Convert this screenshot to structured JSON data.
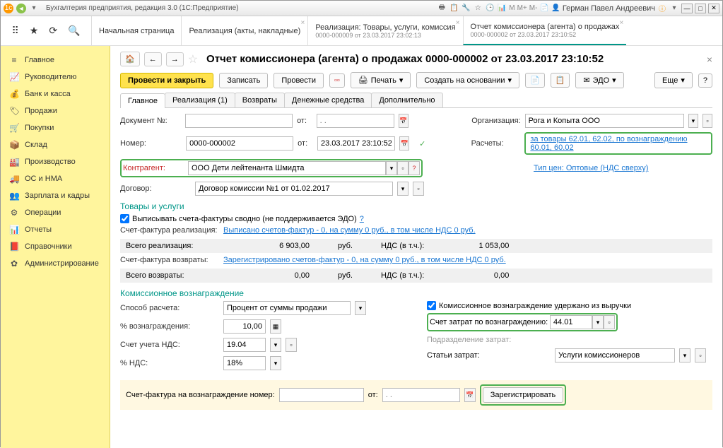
{
  "titlebar": {
    "app_title": "Бухгалтерия предприятия, редакция 3.0 (1С:Предприятие)",
    "user_name": "Герман Павел Андреевич",
    "m_labels": [
      "M",
      "M+",
      "M-"
    ]
  },
  "toolbar_tabs": [
    {
      "label": "Начальная страница",
      "sub": ""
    },
    {
      "label": "Реализация (акты, накладные)",
      "sub": ""
    },
    {
      "label": "Реализация: Товары, услуги, комиссия",
      "sub": "0000-000009 от 23.03.2017 23:02:13"
    },
    {
      "label": "Отчет комиссионера (агента) о продажах",
      "sub": "0000-000002 от 23.03.2017 23:10:52",
      "active": true
    }
  ],
  "sidebar": [
    {
      "icon": "≡",
      "label": "Главное"
    },
    {
      "icon": "📈",
      "label": "Руководителю"
    },
    {
      "icon": "💰",
      "label": "Банк и касса"
    },
    {
      "icon": "🏷",
      "label": "Продажи"
    },
    {
      "icon": "🛒",
      "label": "Покупки"
    },
    {
      "icon": "📦",
      "label": "Склад"
    },
    {
      "icon": "🏭",
      "label": "Производство"
    },
    {
      "icon": "🚚",
      "label": "ОС и НМА"
    },
    {
      "icon": "👥",
      "label": "Зарплата и кадры"
    },
    {
      "icon": "⚙",
      "label": "Операции"
    },
    {
      "icon": "📊",
      "label": "Отчеты"
    },
    {
      "icon": "📕",
      "label": "Справочники"
    },
    {
      "icon": "✿",
      "label": "Администрирование"
    }
  ],
  "main": {
    "title": "Отчет комиссионера (агента) о продажах 0000-000002 от 23.03.2017 23:10:52",
    "actions": {
      "post_close": "Провести и закрыть",
      "save": "Записать",
      "post": "Провести",
      "print": "Печать",
      "create_based": "Создать на основании",
      "edo": "ЭДО",
      "more": "Еще"
    },
    "subtabs": [
      "Главное",
      "Реализация (1)",
      "Возвраты",
      "Денежные средства",
      "Дополнительно"
    ],
    "fields": {
      "doc_num_label": "Документ №:",
      "from_label": "от:",
      "date_placeholder": ". .",
      "org_label": "Организация:",
      "org_value": "Рога и Копыта ООО",
      "number_label": "Номер:",
      "number_value": "0000-000002",
      "datetime_value": "23.03.2017 23:10:52",
      "calc_label": "Расчеты:",
      "calc_link": "за товары 62.01, 62.02, по вознаграждению 60.01, 60.02",
      "counterparty_label": "Контрагент:",
      "counterparty_value": "ООО Дети лейтенанта Шмидта",
      "price_type_label": "Тип цен: Оптовые (НДС сверху)",
      "contract_label": "Договор:",
      "contract_value": "Договор комиссии №1 от 01.02.2017"
    },
    "goods_section": {
      "title": "Товары и услуги",
      "checkbox_label": "Выписывать счета-фактуры сводно (не поддерживается ЭДО)",
      "help": "?",
      "invoice_real_label": "Счет-фактура реализация:",
      "invoice_real_link": "Выписано счетов-фактур - 0, на сумму 0 руб., в том числе НДС 0 руб.",
      "total_real_label": "Всего реализация:",
      "total_real_value": "6 903,00",
      "currency": "руб.",
      "vat_incl_label": "НДС (в т.ч.):",
      "vat_real_value": "1 053,00",
      "invoice_ret_label": "Счет-фактура возвраты:",
      "invoice_ret_link": "Зарегистрировано счетов-фактур - 0, на сумму 0 руб., в том числе НДС 0 руб.",
      "total_ret_label": "Всего возвраты:",
      "total_ret_value": "0,00",
      "vat_ret_value": "0,00"
    },
    "commission_section": {
      "title": "Комиссионное вознаграждение",
      "method_label": "Способ расчета:",
      "method_value": "Процент от суммы продажи",
      "withheld_label": "Комиссионное вознаграждение удержано из выручки",
      "percent_label": "% вознаграждения:",
      "percent_value": "10,00",
      "expense_acc_label": "Счет затрат по вознаграждению:",
      "expense_acc_value": "44.01",
      "vat_acc_label": "Счет учета НДС:",
      "vat_acc_value": "19.04",
      "division_label": "Подразделение затрат:",
      "vat_rate_label": "% НДС:",
      "vat_rate_value": "18%",
      "cost_item_label": "Статьи затрат:",
      "cost_item_value": "Услуги комиссионеров"
    },
    "invoice_bar": {
      "label": "Счет-фактура на вознаграждение номер:",
      "from": "от:",
      "date_placeholder": ". .",
      "register_btn": "Зарегистрировать"
    }
  }
}
